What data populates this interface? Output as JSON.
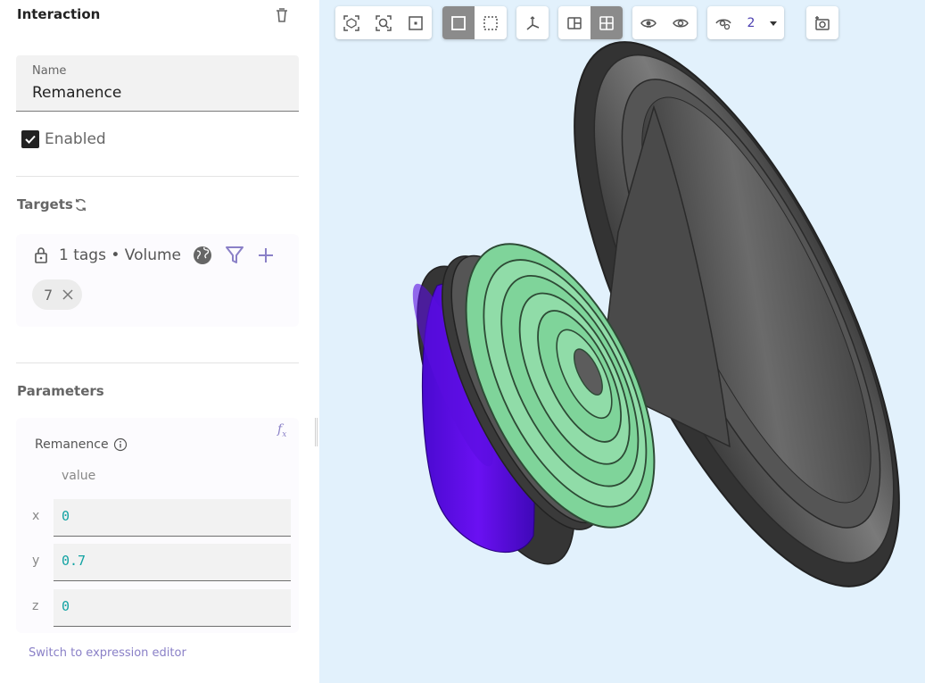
{
  "panel": {
    "title": "Interaction",
    "name": {
      "label": "Name",
      "value": "Remanence"
    },
    "enabled": {
      "label": "Enabled",
      "checked": true
    },
    "targets": {
      "title": "Targets",
      "summary": "1 tags • Volume",
      "chips": [
        "7"
      ]
    },
    "parameters": {
      "title": "Parameters",
      "param_name": "Remanence",
      "column_header": "value",
      "rows": [
        {
          "axis": "x",
          "value": "0"
        },
        {
          "axis": "y",
          "value": "0.7"
        },
        {
          "axis": "z",
          "value": "0"
        }
      ],
      "switch_link": "Switch to expression editor"
    }
  },
  "toolbar": {
    "visibility_count": "2"
  },
  "colors": {
    "accent": "#8a80c7",
    "value_text": "#13a3a3",
    "viewport_bg": "#e2f1fc",
    "magnet_purple": "#6a0ff0",
    "coil_green": "#7fd49a",
    "cone_gray": "#4a4a4a"
  }
}
